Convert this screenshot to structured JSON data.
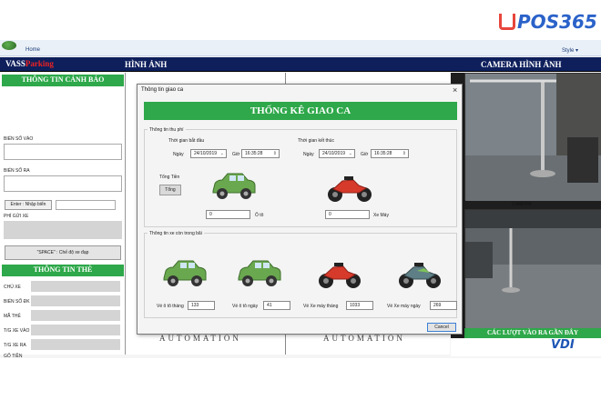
{
  "brand": {
    "name": "POS365"
  },
  "ribbon": {
    "home_tab": "Home",
    "style_menu": "Style ▾"
  },
  "title_bar": {
    "app_name_a": "VASS",
    "app_name_b": "Parking",
    "center": "HÌNH ẢNH",
    "right": "CAMERA HÌNH ẢNH"
  },
  "left_panel": {
    "alert_header": "THÔNG TIN CẢNH BÁO",
    "plate_in_label": "BIỂN SỐ VÀO",
    "plate_out_label": "BIỂN SỐ RA",
    "enter_button": "Enter : Nhập biển",
    "phi_label": "PHÍ GỬI XE",
    "space_button": "\"SPACE\" : Chế độ xe đạp",
    "card_header": "THÔNG TIN THẺ",
    "card_fields": [
      "CHỦ XE",
      "BIỂN SỐ ĐK",
      "MÃ THẺ",
      "T/G XE VÀO",
      "T/G XE RA",
      "GỐ TIỀN"
    ]
  },
  "middle": {
    "watermark_left": "AUTOMATION",
    "watermark_right": "AUTOMATION"
  },
  "right_panel": {
    "camera_label": "CAMERA",
    "recent_header": "CÁC LƯỢT VÀO RA GẦN ĐÂY",
    "vendor_logo": "VDI"
  },
  "colors": {
    "accent_green": "#2ea84a",
    "title_navy": "#0e1f5c",
    "brand_blue": "#2a62c9",
    "brand_red": "#e8463c"
  },
  "dialog": {
    "window_title": "Thông tin giao ca",
    "close_icon": "×",
    "header": "THỐNG KÊ GIAO CA",
    "revenue_group": "Thông tin thu phí",
    "start_label": "Thời gian bắt đầu",
    "end_label": "Thời gian kết thúc",
    "day_label": "Ngày",
    "hour_label": "Giờ",
    "start_date": "24/10/2019",
    "start_time": "16:35:28",
    "end_date": "24/10/2019",
    "end_time": "16:35:28",
    "total_label": "Tổng Tiền",
    "total_button": "Tổng",
    "car_total_value": "0",
    "car_total_unit": "Ô tô",
    "moto_total_value": "0",
    "moto_total_unit": "Xe Máy",
    "remaining_group": "Thông tin xe còn trong bãi",
    "car_monthly_label": "Vé ô tô tháng",
    "car_monthly_value": "133",
    "car_daily_label": "Vé ô tô ngày",
    "car_daily_value": "41",
    "moto_monthly_label": "Vé Xe máy tháng",
    "moto_monthly_value": "1033",
    "moto_daily_label": "Vé Xe máy ngày",
    "moto_daily_value": "269",
    "cancel_button": "Cancel"
  }
}
